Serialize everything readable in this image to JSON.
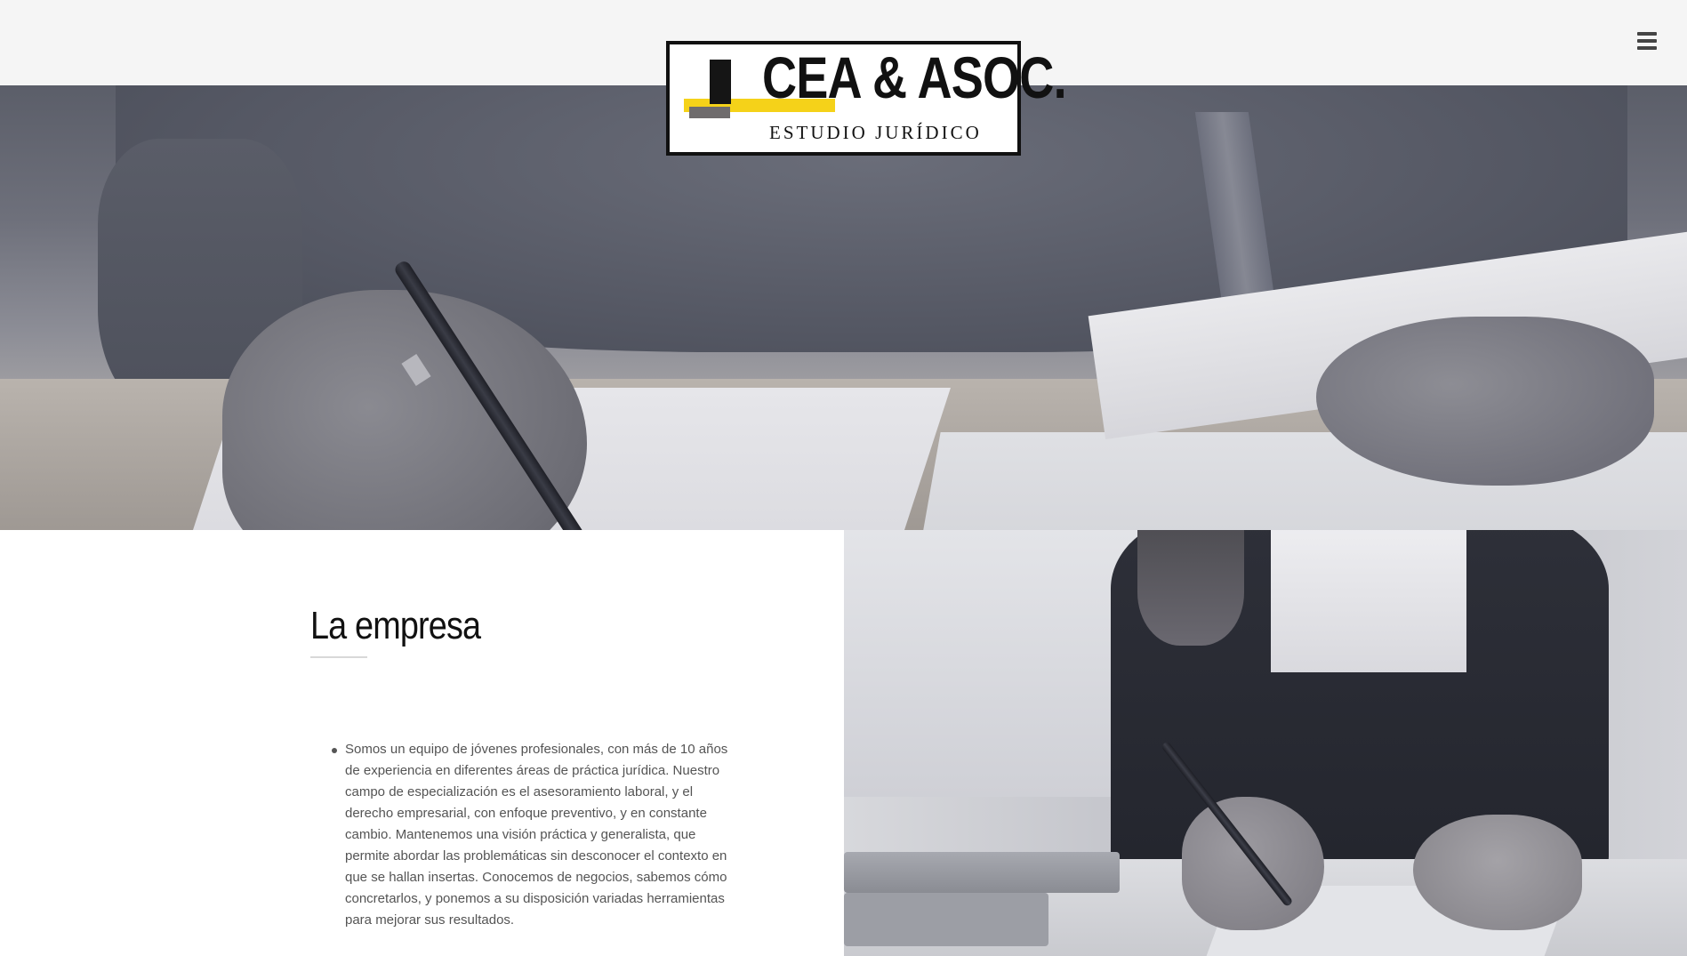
{
  "header": {
    "logo": {
      "brand": "CEA & ASOC.",
      "subtitle": "ESTUDIO JURÍDICO"
    },
    "menu_icon": "hamburger-menu-icon"
  },
  "hero": {
    "image": "hands-writing-on-documents-photo"
  },
  "about": {
    "title": "La empresa",
    "paragraphs": [
      "Somos un equipo de jóvenes profesionales, con más de 10 años de experiencia en diferentes áreas de práctica jurídica. Nuestro campo de especialización es el asesoramiento laboral, y el derecho empresarial, con enfoque preventivo, y en constante cambio. Mantenemos una visión práctica y generalista, que permite abordar las problemáticas sin desconocer el contexto en que se hallan insertas. Conocemos de negocios, sabemos cómo concretarlos, y ponemos a su disposición variadas herramientas para mejorar sus resultados."
    ],
    "side_image": "woman-signing-document-photo"
  },
  "colors": {
    "topbar_bg": "#f5f5f5",
    "logo_yellow": "#f5d219",
    "logo_grey": "#6f6c6d",
    "text_dark": "#111111",
    "body_text": "#545454"
  }
}
